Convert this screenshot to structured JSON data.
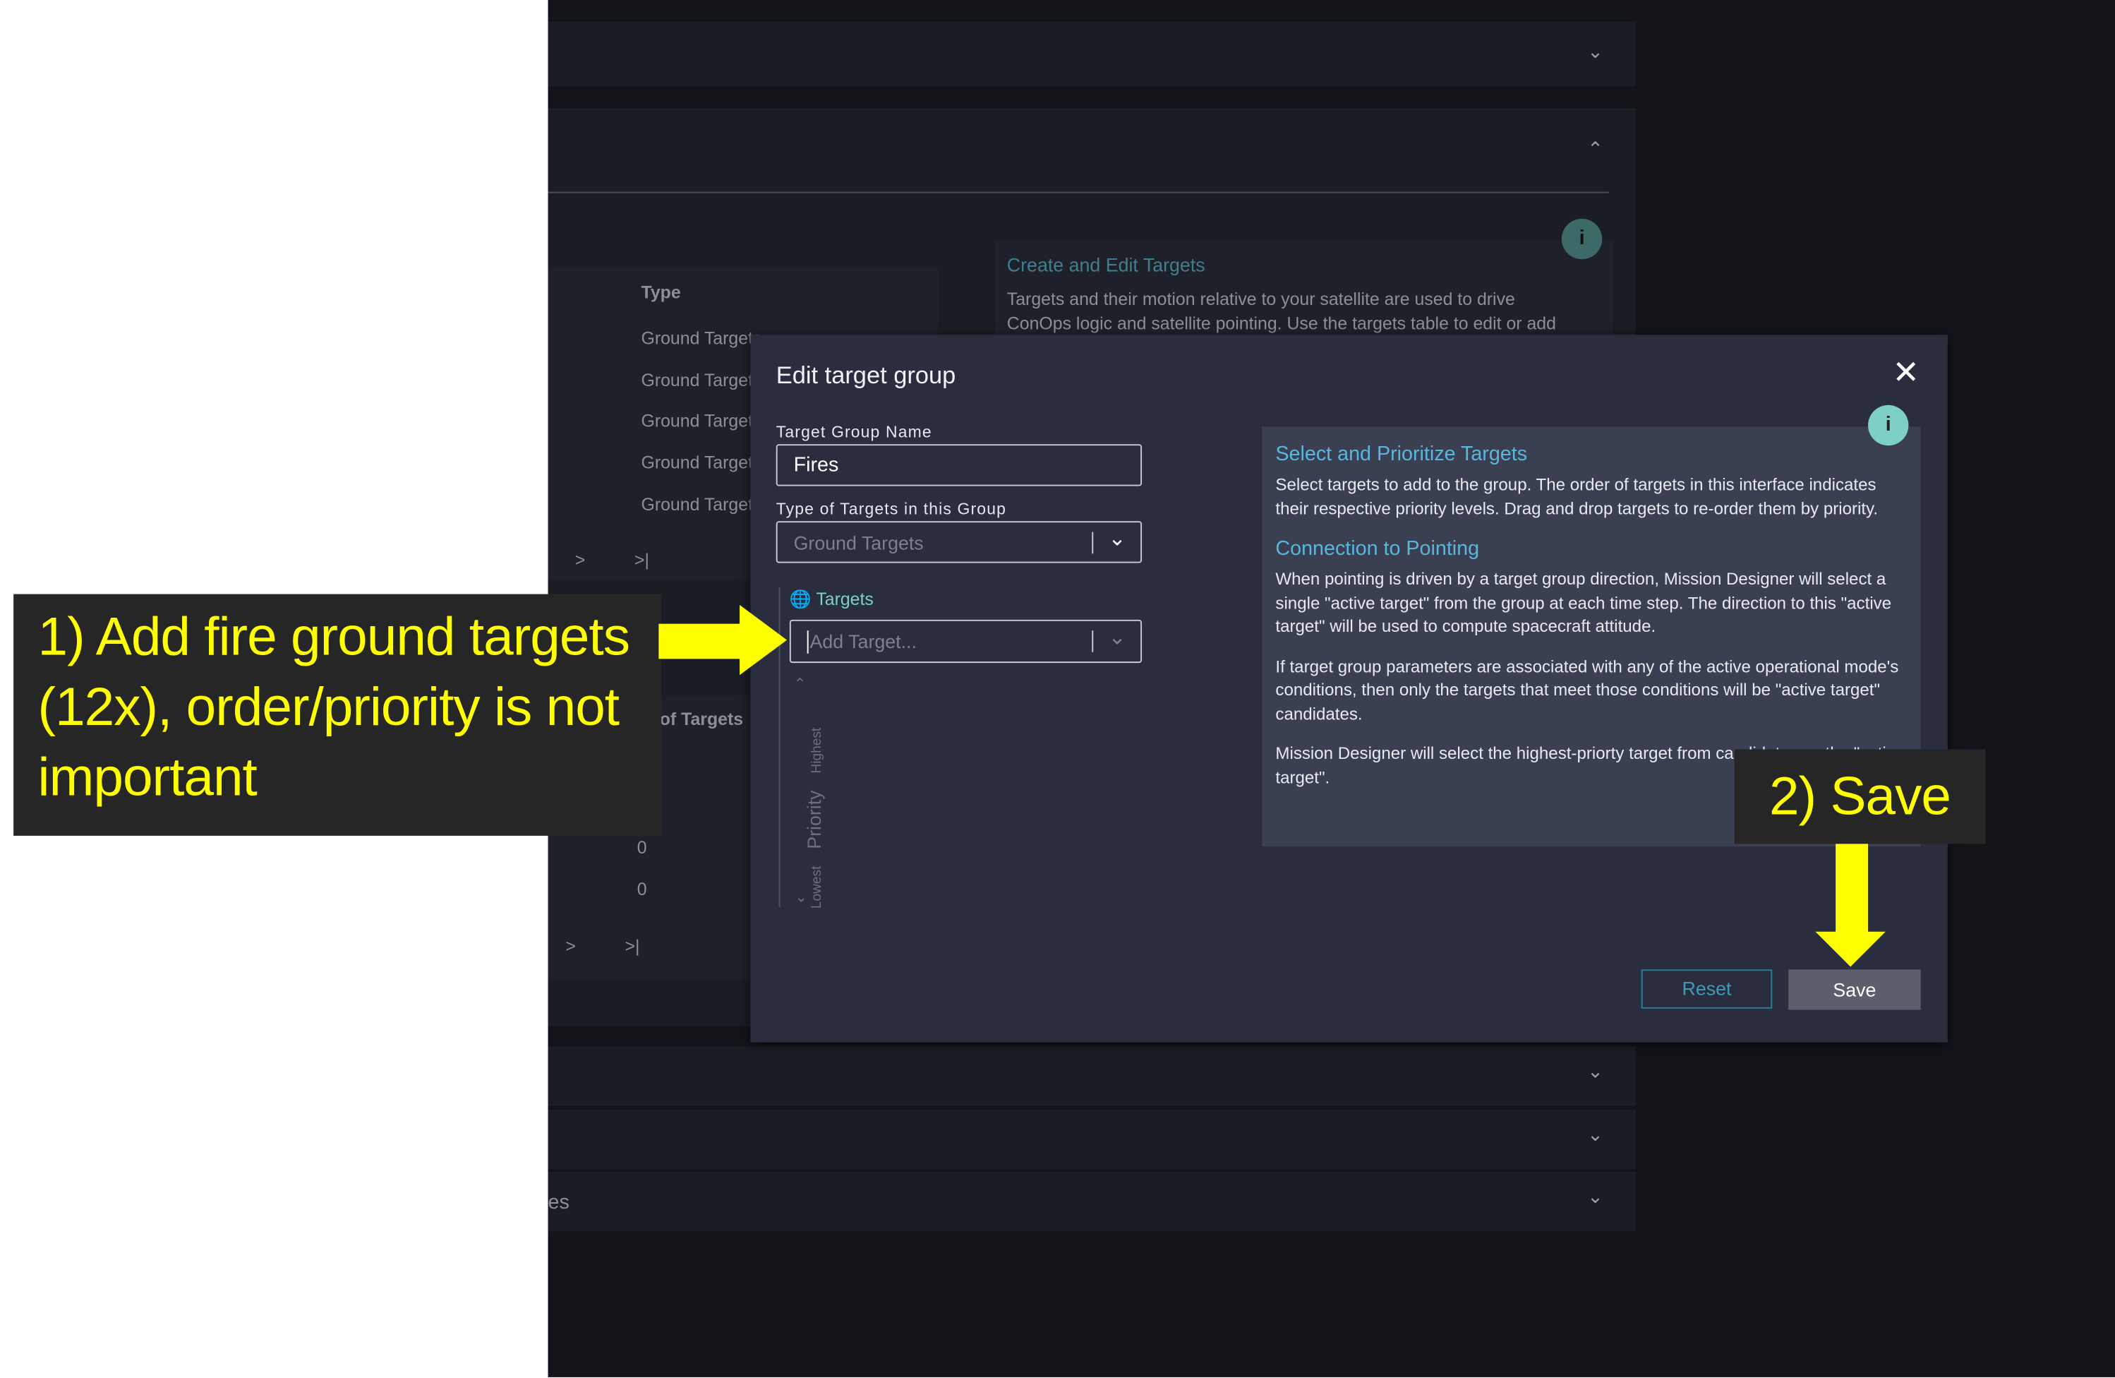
{
  "background": {
    "table1": {
      "header_type": "Type",
      "rows": [
        "Ground Targets",
        "Ground Targets",
        "Ground Targets",
        "Ground Targets",
        "Ground Targets"
      ],
      "next": ">",
      "last": ">|"
    },
    "info": {
      "title": "Create and Edit Targets",
      "lines": [
        "Targets and their motion relative to your satellite are used to drive",
        "ConOps logic and satellite pointing. Use the targets table to edit or add"
      ]
    },
    "table2": {
      "header": "Number of Targets",
      "rows": [
        "0",
        "0"
      ],
      "next": ">",
      "last": ">|"
    },
    "panel_label": "es"
  },
  "modal": {
    "title": "Edit target group",
    "name_label": "Target Group Name",
    "name_value": "Fires",
    "type_label": "Type of Targets in this Group",
    "type_value": "Ground Targets",
    "targets_label": "Targets",
    "add_placeholder": "Add Target...",
    "priority": "Priority",
    "highest": "Highest",
    "lowest": "Lowest",
    "help": {
      "title1": "Select and Prioritize Targets",
      "p1": "Select targets to add to the group. The order of targets in this interface indicates their respective priority levels. Drag and drop targets to re-order them by priority.",
      "title2": "Connection to Pointing",
      "p2": "When pointing is driven by a target group direction, Mission Designer will select a single \"active target\" from the group at each time step. The direction to this \"active target\" will be used to compute spacecraft attitude.",
      "p3": "If target group parameters are associated with any of the active operational mode's conditions, then only the targets that meet those conditions will be \"active target\" candidates.",
      "p4": "Mission Designer will select the highest-priorty target from candidates as the \"active target\"."
    },
    "reset": "Reset",
    "save": "Save"
  },
  "annotations": {
    "step1": "1) Add fire ground targets (12x), order/priority is not important",
    "step2": "2) Save"
  },
  "colors": {
    "accent": "#58b7dd",
    "teal": "#7ecfc6",
    "annotation": "#ffff00"
  }
}
